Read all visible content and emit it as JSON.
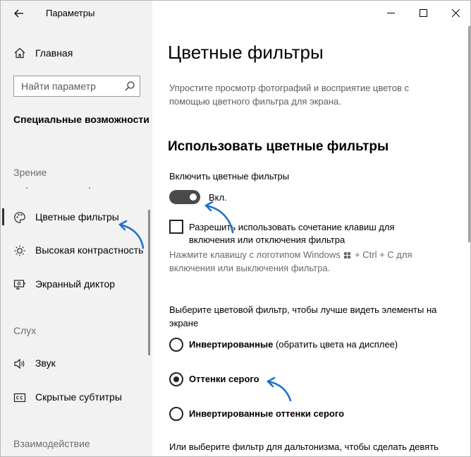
{
  "window": {
    "title": "Параметры",
    "controls": [
      "minimize-icon",
      "maximize-icon",
      "close-icon"
    ]
  },
  "sidebar": {
    "back_icon": "back-arrow-icon",
    "home": {
      "label": "Главная",
      "icon": "home-icon"
    },
    "search": {
      "placeholder": "Найти параметр",
      "value": "",
      "icon": "search-icon"
    },
    "section_title": "Специальные возможности",
    "groups": {
      "vision": "Зрение",
      "hearing": "Слух",
      "interaction": "Взаимодействие"
    },
    "items": [
      {
        "label": "Цветные фильтры",
        "icon": "palette-icon",
        "selected": true
      },
      {
        "label": "Высокая контрастность",
        "icon": "brightness-icon",
        "selected": false
      },
      {
        "label": "Экранный диктор",
        "icon": "narrator-icon",
        "selected": false
      },
      {
        "label": "Звук",
        "icon": "speaker-icon",
        "selected": false
      },
      {
        "label": "Скрытые субтитры",
        "icon": "closed-captions-icon",
        "selected": false
      }
    ]
  },
  "main": {
    "title": "Цветные фильтры",
    "description": "Упростите просмотр фотографий и восприятие цветов с помощью цветного фильтра для экрана.",
    "subheading": "Использовать цветные фильтры",
    "toggle": {
      "label": "Включить цветные фильтры",
      "on": true,
      "state_text": "Вкл."
    },
    "shortcut_checkbox": {
      "checked": false,
      "label": "Разрешить использовать сочетание клавиш для включения или отключения фильтра"
    },
    "hint": {
      "before": "Нажмите клавишу с логотипом Windows",
      "after": "+ Ctrl + C для включения или выключения фильтра."
    },
    "filter_prompt": "Выберите цветовой фильтр, чтобы лучше видеть элементы на экране",
    "filters": [
      {
        "name": "Инвертированные",
        "note": "(обратить цвета на дисплее)",
        "selected": false
      },
      {
        "name": "Оттенки серого",
        "note": "",
        "selected": true
      },
      {
        "name": "Инвертированные оттенки серого",
        "note": "",
        "selected": false
      }
    ],
    "bottom_text": "Или выберите фильтр для дальтонизма, чтобы сделать девять"
  },
  "colors": {
    "sidebar_bg": "#f2f2f2",
    "toggle_on": "#4a4a4a",
    "annotation_arrow": "#1e73c8"
  }
}
